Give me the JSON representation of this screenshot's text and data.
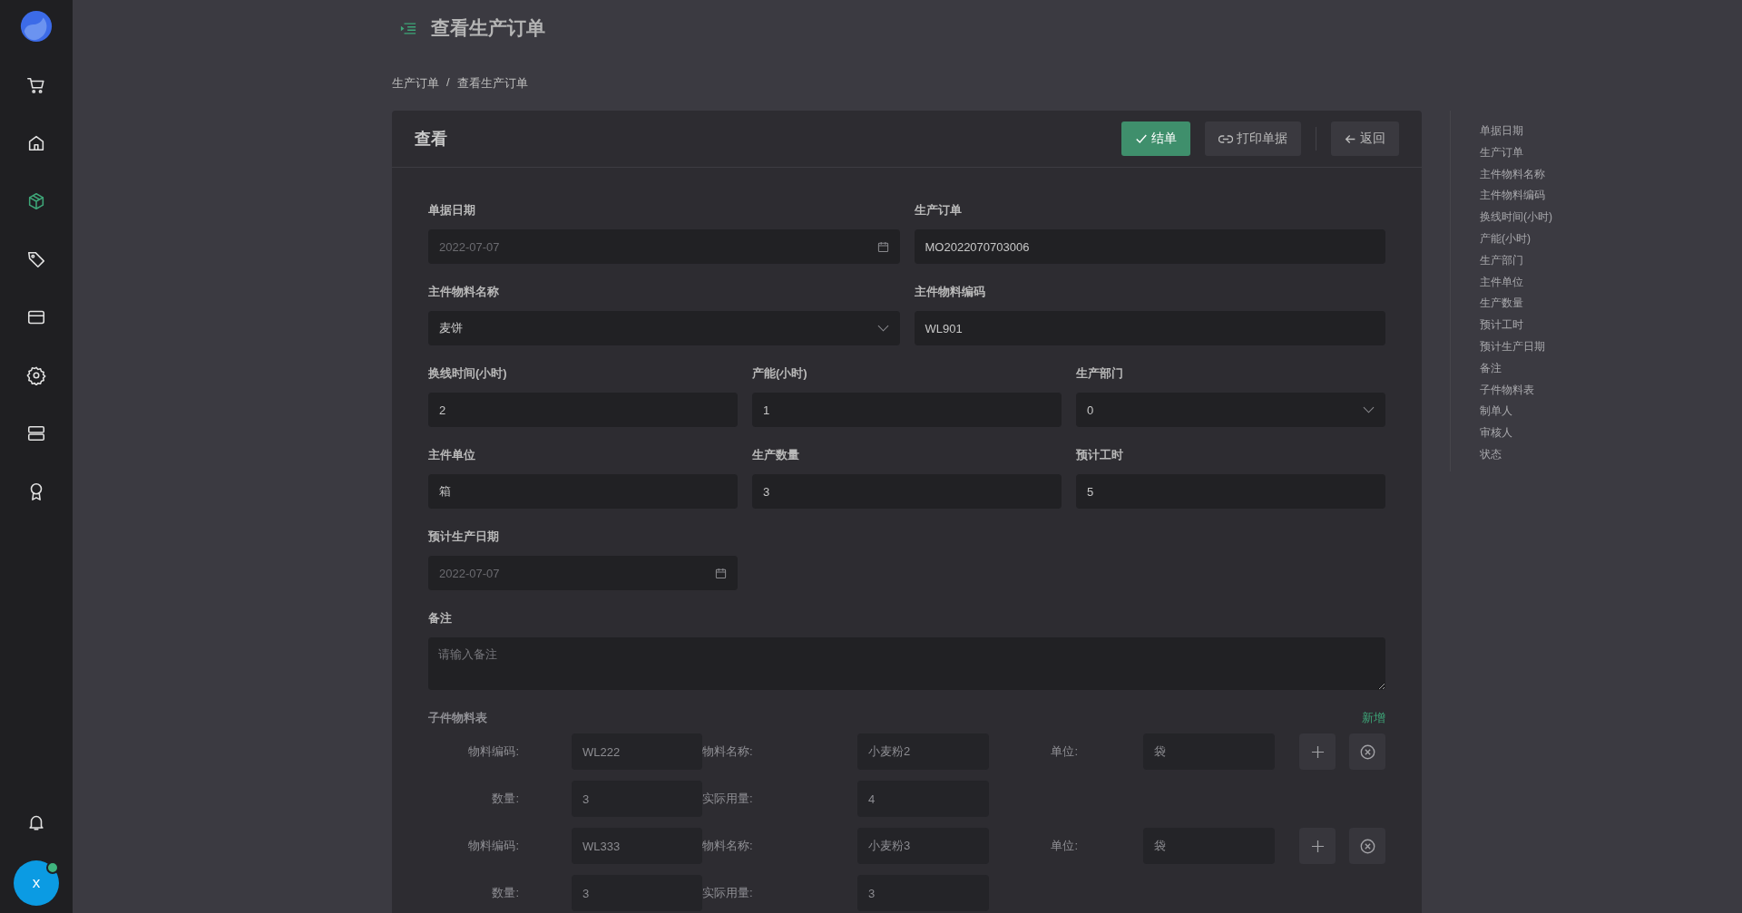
{
  "sidebar": {
    "items": [
      {
        "kind": "cart",
        "selected": false
      },
      {
        "kind": "home",
        "selected": false
      },
      {
        "kind": "cube",
        "selected": true
      },
      {
        "kind": "tag",
        "selected": false
      },
      {
        "kind": "card",
        "selected": false
      },
      {
        "kind": "gear",
        "selected": false
      },
      {
        "kind": "server",
        "selected": false
      },
      {
        "kind": "award",
        "selected": false
      }
    ],
    "avatar": {
      "initial": "x",
      "online": true
    }
  },
  "page_title": "查看生产订单",
  "breadcrumb": [
    "生产订单",
    "查看生产订单"
  ],
  "breadcrumb_separator": "/",
  "card": {
    "title": "查看",
    "buttons": [
      {
        "kind": "finish",
        "label": "结单"
      },
      {
        "kind": "print",
        "label": "打印单据"
      },
      {
        "kind": "back",
        "label": "返回"
      }
    ]
  },
  "form": {
    "rows": [
      [
        {
          "label": "单据日期",
          "kind": "date",
          "value": "2022-07-07",
          "disabled": true
        },
        {
          "label": "生产订单",
          "kind": "text",
          "value": "MO2022070703006",
          "disabled": false
        }
      ],
      [
        {
          "label": "主件物料名称",
          "kind": "select",
          "value": "麦饼",
          "disabled": false
        },
        {
          "label": "主件物料编码",
          "kind": "text",
          "value": "WL901",
          "disabled": false
        }
      ],
      [
        {
          "label": "换线时间(小时)",
          "kind": "text",
          "value": "2",
          "disabled": false
        },
        {
          "label": "产能(小时)",
          "kind": "text",
          "value": "1",
          "disabled": false
        },
        {
          "label": "生产部门",
          "kind": "select",
          "value": "0",
          "disabled": false
        }
      ],
      [
        {
          "label": "主件单位",
          "kind": "text",
          "value": "箱",
          "disabled": false
        },
        {
          "label": "生产数量",
          "kind": "text",
          "value": "3",
          "disabled": false
        },
        {
          "label": "预计工时",
          "kind": "text",
          "value": "5",
          "disabled": false
        }
      ],
      [
        {
          "label": "预计生产日期",
          "kind": "date",
          "value": "2022-07-07",
          "disabled": true
        }
      ]
    ],
    "remark": {
      "label": "备注",
      "placeholder": "请输入备注"
    }
  },
  "sub_table": {
    "title": "子件物料表",
    "add_link": "新增",
    "items": [
      {
        "code_label": "物料编码:",
        "code": "WL222",
        "name_label": "物料名称:",
        "name": "小麦粉2",
        "unit_label": "单位:",
        "unit": "袋",
        "qty_label": "数量:",
        "qty": "3",
        "usage_label": "实际用量:",
        "usage": "4"
      },
      {
        "code_label": "物料编码:",
        "code": "WL333",
        "name_label": "物料名称:",
        "name": "小麦粉3",
        "unit_label": "单位:",
        "unit": "袋",
        "qty_label": "数量:",
        "qty": "3",
        "usage_label": "实际用量:",
        "usage": "3"
      }
    ]
  },
  "anchor_nav": [
    "单据日期",
    "生产订单",
    "主件物料名称",
    "主件物料编码",
    "换线时间(小时)",
    "产能(小时)",
    "生产部门",
    "主件单位",
    "生产数量",
    "预计工时",
    "预计生产日期",
    "备注",
    "子件物料表",
    "制单人",
    "审核人",
    "状态"
  ]
}
